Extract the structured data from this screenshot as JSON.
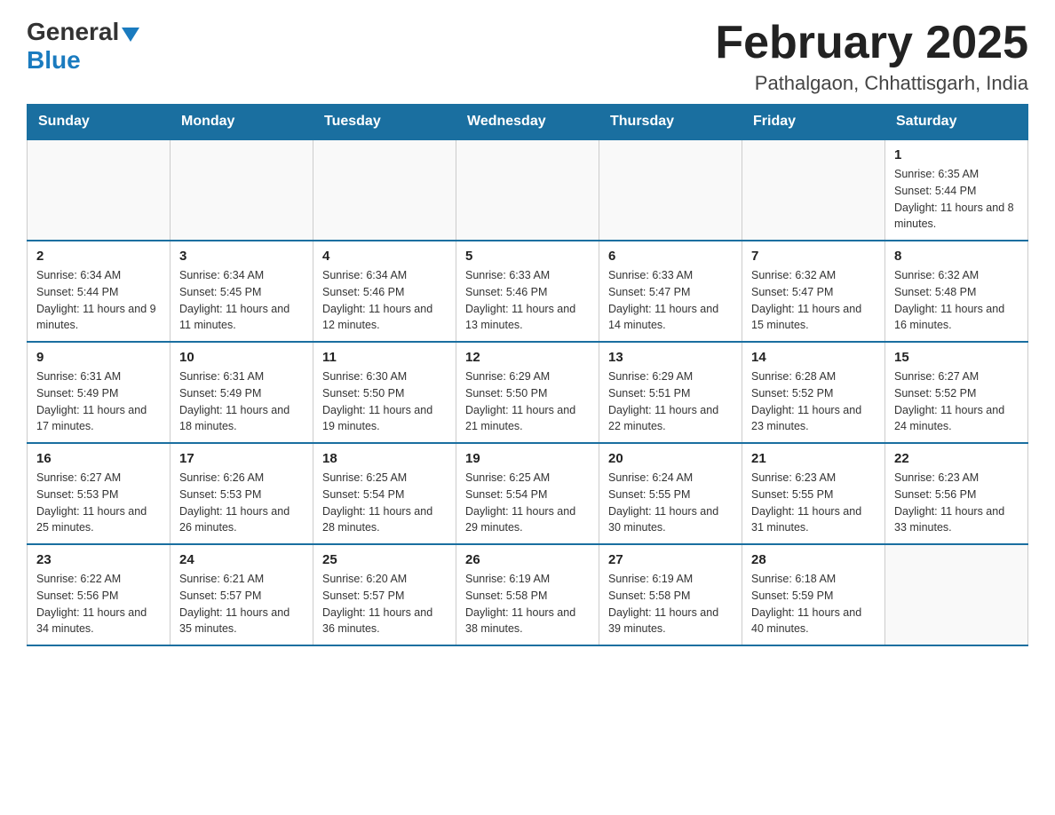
{
  "header": {
    "logo_general": "General",
    "logo_blue": "Blue",
    "month_title": "February 2025",
    "location": "Pathalgaon, Chhattisgarh, India"
  },
  "days_of_week": [
    "Sunday",
    "Monday",
    "Tuesday",
    "Wednesday",
    "Thursday",
    "Friday",
    "Saturday"
  ],
  "weeks": [
    [
      {
        "day": "",
        "info": ""
      },
      {
        "day": "",
        "info": ""
      },
      {
        "day": "",
        "info": ""
      },
      {
        "day": "",
        "info": ""
      },
      {
        "day": "",
        "info": ""
      },
      {
        "day": "",
        "info": ""
      },
      {
        "day": "1",
        "info": "Sunrise: 6:35 AM\nSunset: 5:44 PM\nDaylight: 11 hours and 8 minutes."
      }
    ],
    [
      {
        "day": "2",
        "info": "Sunrise: 6:34 AM\nSunset: 5:44 PM\nDaylight: 11 hours and 9 minutes."
      },
      {
        "day": "3",
        "info": "Sunrise: 6:34 AM\nSunset: 5:45 PM\nDaylight: 11 hours and 11 minutes."
      },
      {
        "day": "4",
        "info": "Sunrise: 6:34 AM\nSunset: 5:46 PM\nDaylight: 11 hours and 12 minutes."
      },
      {
        "day": "5",
        "info": "Sunrise: 6:33 AM\nSunset: 5:46 PM\nDaylight: 11 hours and 13 minutes."
      },
      {
        "day": "6",
        "info": "Sunrise: 6:33 AM\nSunset: 5:47 PM\nDaylight: 11 hours and 14 minutes."
      },
      {
        "day": "7",
        "info": "Sunrise: 6:32 AM\nSunset: 5:47 PM\nDaylight: 11 hours and 15 minutes."
      },
      {
        "day": "8",
        "info": "Sunrise: 6:32 AM\nSunset: 5:48 PM\nDaylight: 11 hours and 16 minutes."
      }
    ],
    [
      {
        "day": "9",
        "info": "Sunrise: 6:31 AM\nSunset: 5:49 PM\nDaylight: 11 hours and 17 minutes."
      },
      {
        "day": "10",
        "info": "Sunrise: 6:31 AM\nSunset: 5:49 PM\nDaylight: 11 hours and 18 minutes."
      },
      {
        "day": "11",
        "info": "Sunrise: 6:30 AM\nSunset: 5:50 PM\nDaylight: 11 hours and 19 minutes."
      },
      {
        "day": "12",
        "info": "Sunrise: 6:29 AM\nSunset: 5:50 PM\nDaylight: 11 hours and 21 minutes."
      },
      {
        "day": "13",
        "info": "Sunrise: 6:29 AM\nSunset: 5:51 PM\nDaylight: 11 hours and 22 minutes."
      },
      {
        "day": "14",
        "info": "Sunrise: 6:28 AM\nSunset: 5:52 PM\nDaylight: 11 hours and 23 minutes."
      },
      {
        "day": "15",
        "info": "Sunrise: 6:27 AM\nSunset: 5:52 PM\nDaylight: 11 hours and 24 minutes."
      }
    ],
    [
      {
        "day": "16",
        "info": "Sunrise: 6:27 AM\nSunset: 5:53 PM\nDaylight: 11 hours and 25 minutes."
      },
      {
        "day": "17",
        "info": "Sunrise: 6:26 AM\nSunset: 5:53 PM\nDaylight: 11 hours and 26 minutes."
      },
      {
        "day": "18",
        "info": "Sunrise: 6:25 AM\nSunset: 5:54 PM\nDaylight: 11 hours and 28 minutes."
      },
      {
        "day": "19",
        "info": "Sunrise: 6:25 AM\nSunset: 5:54 PM\nDaylight: 11 hours and 29 minutes."
      },
      {
        "day": "20",
        "info": "Sunrise: 6:24 AM\nSunset: 5:55 PM\nDaylight: 11 hours and 30 minutes."
      },
      {
        "day": "21",
        "info": "Sunrise: 6:23 AM\nSunset: 5:55 PM\nDaylight: 11 hours and 31 minutes."
      },
      {
        "day": "22",
        "info": "Sunrise: 6:23 AM\nSunset: 5:56 PM\nDaylight: 11 hours and 33 minutes."
      }
    ],
    [
      {
        "day": "23",
        "info": "Sunrise: 6:22 AM\nSunset: 5:56 PM\nDaylight: 11 hours and 34 minutes."
      },
      {
        "day": "24",
        "info": "Sunrise: 6:21 AM\nSunset: 5:57 PM\nDaylight: 11 hours and 35 minutes."
      },
      {
        "day": "25",
        "info": "Sunrise: 6:20 AM\nSunset: 5:57 PM\nDaylight: 11 hours and 36 minutes."
      },
      {
        "day": "26",
        "info": "Sunrise: 6:19 AM\nSunset: 5:58 PM\nDaylight: 11 hours and 38 minutes."
      },
      {
        "day": "27",
        "info": "Sunrise: 6:19 AM\nSunset: 5:58 PM\nDaylight: 11 hours and 39 minutes."
      },
      {
        "day": "28",
        "info": "Sunrise: 6:18 AM\nSunset: 5:59 PM\nDaylight: 11 hours and 40 minutes."
      },
      {
        "day": "",
        "info": ""
      }
    ]
  ]
}
